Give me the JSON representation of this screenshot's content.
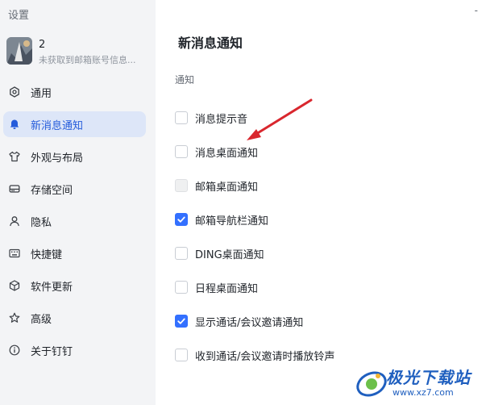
{
  "window": {
    "title": "设置",
    "minimize_glyph": "-"
  },
  "profile": {
    "name": "2",
    "email_status": "未获取到邮箱账号信息..."
  },
  "sidebar": {
    "items": [
      {
        "label": "通用",
        "icon": "settings-icon",
        "active": false
      },
      {
        "label": "新消息通知",
        "icon": "bell-icon",
        "active": true
      },
      {
        "label": "外观与布局",
        "icon": "shirt-icon",
        "active": false
      },
      {
        "label": "存储空间",
        "icon": "storage-icon",
        "active": false
      },
      {
        "label": "隐私",
        "icon": "user-icon",
        "active": false
      },
      {
        "label": "快捷键",
        "icon": "keyboard-icon",
        "active": false
      },
      {
        "label": "软件更新",
        "icon": "cube-icon",
        "active": false
      },
      {
        "label": "高级",
        "icon": "star-icon",
        "active": false
      },
      {
        "label": "关于钉钉",
        "icon": "info-icon",
        "active": false
      }
    ]
  },
  "main": {
    "title": "新消息通知",
    "section_label": "通知",
    "options": [
      {
        "label": "消息提示音",
        "checked": false,
        "disabled": false
      },
      {
        "label": "消息桌面通知",
        "checked": false,
        "disabled": false
      },
      {
        "label": "邮箱桌面通知",
        "checked": false,
        "disabled": true
      },
      {
        "label": "邮箱导航栏通知",
        "checked": true,
        "disabled": false
      },
      {
        "label": "DING桌面通知",
        "checked": false,
        "disabled": false
      },
      {
        "label": "日程桌面通知",
        "checked": false,
        "disabled": false
      },
      {
        "label": "显示通话/会议邀请通知",
        "checked": true,
        "disabled": false
      },
      {
        "label": "收到通话/会议邀请时播放铃声",
        "checked": false,
        "disabled": false
      }
    ]
  },
  "annotation": {
    "arrow_color": "#d9272e"
  },
  "watermark": {
    "brand": "极光下载站",
    "url": "www.xz7.com"
  },
  "colors": {
    "accent": "#3370ff",
    "active_bg": "#dde6f8",
    "active_text": "#245bdb",
    "sidebar_bg": "#f3f4f6"
  }
}
